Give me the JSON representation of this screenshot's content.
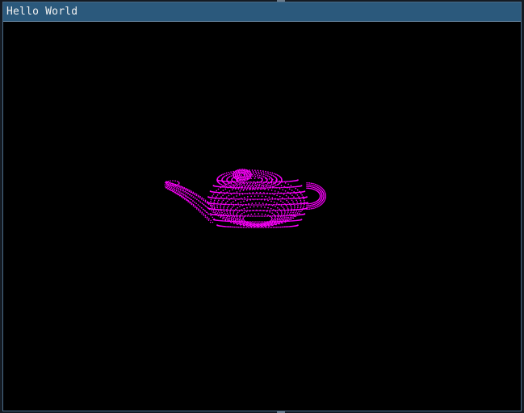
{
  "window": {
    "title": "Hello World"
  },
  "scene": {
    "object_icon": "teapot-point-cloud",
    "background_color": "#000000",
    "point_color": "#ff00ff"
  }
}
